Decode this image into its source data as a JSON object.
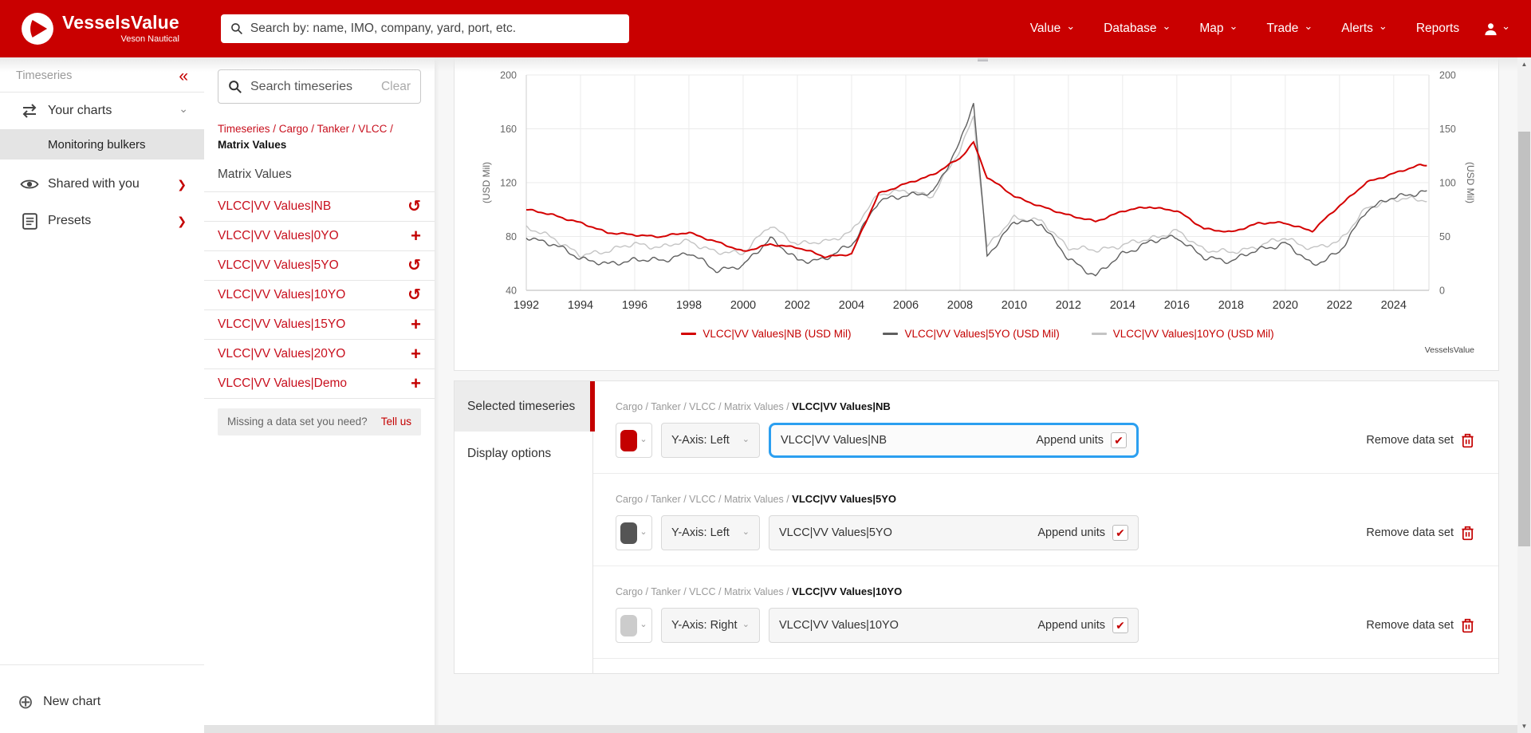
{
  "header": {
    "brand": "VesselsValue",
    "brand_sub": "Veson Nautical",
    "search_placeholder": "Search by: name, IMO, company, yard, port, etc.",
    "nav": [
      {
        "label": "Value",
        "dropdown": true
      },
      {
        "label": "Database",
        "dropdown": true
      },
      {
        "label": "Map",
        "dropdown": true
      },
      {
        "label": "Trade",
        "dropdown": true
      },
      {
        "label": "Alerts",
        "dropdown": true
      },
      {
        "label": "Reports",
        "dropdown": false
      }
    ]
  },
  "sidebar": {
    "section_label": "Timeseries",
    "your_charts": "Your charts",
    "selected_chart": "Monitoring bulkers",
    "shared": "Shared with you",
    "presets": "Presets",
    "new_chart": "New chart"
  },
  "browser": {
    "search_placeholder": "Search timeseries",
    "clear_label": "Clear",
    "breadcrumb": "Timeseries / Cargo / Tanker / VLCC /",
    "breadcrumb_current": "Matrix Values",
    "section_title": "Matrix Values",
    "items": [
      {
        "label": "VLCC|VV Values|NB",
        "icon": "undo-icon",
        "icon_class": "act undo-icon",
        "glyph": "↺"
      },
      {
        "label": "VLCC|VV Values|0YO",
        "icon": "plus-icon",
        "icon_class": "act plus-icon",
        "glyph": "+"
      },
      {
        "label": "VLCC|VV Values|5YO",
        "icon": "undo-icon",
        "icon_class": "act undo-icon",
        "glyph": "↺"
      },
      {
        "label": "VLCC|VV Values|10YO",
        "icon": "undo-icon",
        "icon_class": "act undo-icon",
        "glyph": "↺"
      },
      {
        "label": "VLCC|VV Values|15YO",
        "icon": "plus-icon",
        "icon_class": "act plus-icon",
        "glyph": "+"
      },
      {
        "label": "VLCC|VV Values|20YO",
        "icon": "plus-icon",
        "icon_class": "act plus-icon",
        "glyph": "+"
      },
      {
        "label": "VLCC|VV Values|Demo",
        "icon": "plus-icon",
        "icon_class": "act plus-icon",
        "glyph": "+"
      }
    ],
    "missing_prompt": "Missing a data set you need?",
    "missing_link": "Tell us"
  },
  "chart": {
    "watermark": "VesselsValue"
  },
  "chart_data": {
    "type": "line",
    "x_ticks": [
      1992,
      1994,
      1996,
      1998,
      2000,
      2002,
      2004,
      2006,
      2008,
      2010,
      2012,
      2014,
      2016,
      2018,
      2020,
      2022,
      2024
    ],
    "left_axis": {
      "label": "(USD Mil)",
      "ticks": [
        200,
        160,
        120,
        80,
        40
      ],
      "range": [
        40,
        200
      ]
    },
    "right_axis": {
      "label": "(USD Mil)",
      "ticks": [
        200,
        150,
        100,
        50,
        0
      ],
      "range": [
        0,
        200
      ]
    },
    "x_range": [
      1992,
      2025.3
    ],
    "grid": true,
    "legend_position": "bottom",
    "x": [
      1992,
      1993,
      1994,
      1995,
      1996,
      1997,
      1998,
      1999,
      2000,
      2001,
      2002,
      2003,
      2004,
      2005,
      2006,
      2007,
      2008,
      2008.5,
      2009,
      2010,
      2011,
      2012,
      2013,
      2014,
      2015,
      2016,
      2017,
      2018,
      2019,
      2020,
      2021,
      2022,
      2023,
      2024,
      2025
    ],
    "series": [
      {
        "name": "VLCC|VV Values|10YO",
        "legend_label": "VLCC|VV Values|10YO (USD Mil)",
        "axis": "right",
        "color": "#c4c4c4",
        "noise": 3.0,
        "values": [
          58,
          49,
          32,
          37,
          43,
          40,
          46,
          35,
          35,
          60,
          43,
          45,
          54,
          90,
          92,
          88,
          130,
          162,
          40,
          68,
          64,
          40,
          37,
          42,
          48,
          55,
          38,
          35,
          41,
          49,
          38,
          46,
          76,
          85,
          84
        ]
      },
      {
        "name": "VLCC|VV Values|5YO",
        "legend_label": "VLCC|VV Values|5YO (USD Mil)",
        "axis": "left",
        "color": "#5f5f5f",
        "noise": 2.5,
        "values": [
          80,
          74,
          64,
          59,
          63,
          62,
          68,
          55,
          58,
          79,
          62,
          63,
          74,
          106,
          111,
          112,
          150,
          179,
          66,
          91,
          90,
          63,
          51,
          67,
          76,
          80,
          64,
          62,
          70,
          75,
          59,
          68,
          100,
          109,
          113
        ]
      },
      {
        "name": "VLCC|VV Values|NB",
        "legend_label": "VLCC|VV Values|NB (USD Mil)",
        "axis": "left",
        "color": "#d40000",
        "noise": 0.9,
        "values": [
          100,
          96,
          90,
          83,
          81,
          80,
          83,
          76,
          69,
          74,
          72,
          65,
          67,
          112,
          119,
          126,
          138,
          150,
          124,
          110,
          102,
          96,
          91,
          99,
          102,
          99,
          86,
          83,
          90,
          90,
          84,
          103,
          120,
          127,
          133
        ]
      }
    ],
    "legend_order": [
      2,
      1,
      0
    ]
  },
  "panel": {
    "tab_selected": "Selected timeseries",
    "tab_display": "Display options",
    "rows": [
      {
        "breadcrumb": "Cargo / Tanker / VLCC / Matrix Values / ",
        "name": "VLCC|VV Values|NB",
        "swatch": "#c40000",
        "y_axis": "Y-Axis: Left",
        "input_value": "VLCC|VV Values|NB",
        "append_label": "Append units",
        "check": "✔",
        "focused": true,
        "remove_label": "Remove data set"
      },
      {
        "breadcrumb": "Cargo / Tanker / VLCC / Matrix Values / ",
        "name": "VLCC|VV Values|5YO",
        "swatch": "#555555",
        "y_axis": "Y-Axis: Left",
        "input_value": "VLCC|VV Values|5YO",
        "append_label": "Append units",
        "check": "✔",
        "focused": false,
        "remove_label": "Remove data set"
      },
      {
        "breadcrumb": "Cargo / Tanker / VLCC / Matrix Values / ",
        "name": "VLCC|VV Values|10YO",
        "swatch": "#cccccc",
        "y_axis": "Y-Axis: Right",
        "input_value": "VLCC|VV Values|10YO",
        "append_label": "Append units",
        "check": "✔",
        "focused": false,
        "remove_label": "Remove data set"
      }
    ]
  }
}
